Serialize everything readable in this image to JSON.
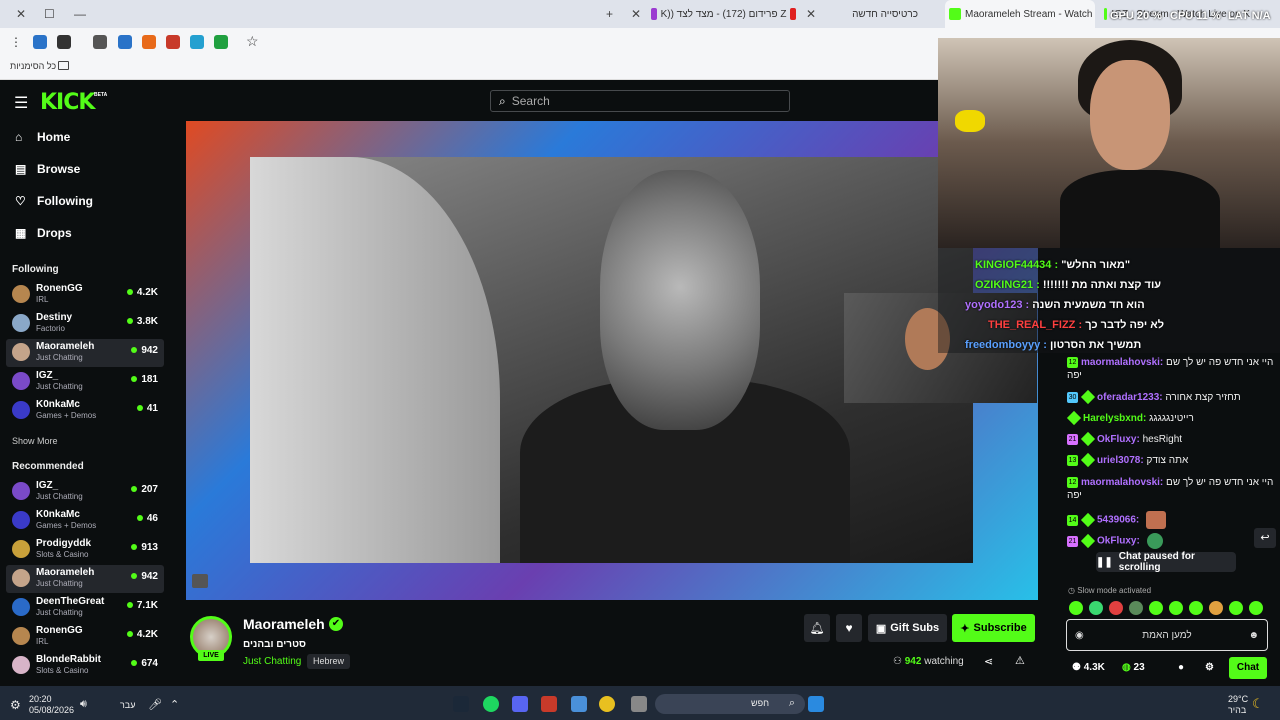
{
  "browser": {
    "tabs": [
      {
        "label": "K)) פרידום (172) - מצד לצד Z"
      },
      {
        "label": "כרטיסייה חדשה"
      },
      {
        "label": "Maorameleh Stream - Watch"
      },
      {
        "label": "IGZ_ Stream - Watch Live on K"
      }
    ],
    "overlay_stats": {
      "gpu": "GPU 20 %",
      "cpu": "CPU 11 %",
      "lat": "LAT N/A"
    },
    "bookmarks_label": "כל הסימניות"
  },
  "header": {
    "logo": "KICK",
    "beta": "BETA",
    "search_placeholder": "Search"
  },
  "sidebar": {
    "nav": [
      {
        "label": "Home",
        "icon": "home-icon"
      },
      {
        "label": "Browse",
        "icon": "browse-icon"
      },
      {
        "label": "Following",
        "icon": "heart-icon"
      },
      {
        "label": "Drops",
        "icon": "drops-icon"
      }
    ],
    "following_title": "Following",
    "following": [
      {
        "name": "RonenGG",
        "category": "IRL",
        "viewers": "4.2K"
      },
      {
        "name": "Destiny",
        "category": "Factorio",
        "viewers": "3.8K"
      },
      {
        "name": "Maorameleh",
        "category": "Just Chatting",
        "viewers": "942"
      },
      {
        "name": "IGZ_",
        "category": "Just Chatting",
        "viewers": "181"
      },
      {
        "name": "K0nkaMc",
        "category": "Games + Demos",
        "viewers": "41"
      }
    ],
    "show_more": "Show More",
    "recommended_title": "Recommended",
    "recommended": [
      {
        "name": "IGZ_",
        "category": "Just Chatting",
        "viewers": "207"
      },
      {
        "name": "K0nkaMc",
        "category": "Games + Demos",
        "viewers": "46"
      },
      {
        "name": "Prodigyddk",
        "category": "Slots & Casino",
        "viewers": "913"
      },
      {
        "name": "Maorameleh",
        "category": "Just Chatting",
        "viewers": "942"
      },
      {
        "name": "DeenTheGreat",
        "category": "Just Chatting",
        "viewers": "7.1K"
      },
      {
        "name": "RonenGG",
        "category": "IRL",
        "viewers": "4.2K"
      },
      {
        "name": "BlondeRabbit",
        "category": "Slots & Casino",
        "viewers": "674"
      }
    ]
  },
  "stream": {
    "channel": "Maorameleh",
    "live": "LIVE",
    "title": "סטרים ובהנים",
    "category": "Just Chatting",
    "language": "Hebrew",
    "gift_subs": "Gift Subs",
    "subscribe": "Subscribe",
    "viewers": "942",
    "watching": "watching"
  },
  "overlay_chat": [
    {
      "user": "KINGIOF44434 :",
      "text": "\"מאור החלש\"",
      "color": "#53fc18"
    },
    {
      "user": "OZIKING21 :",
      "text": "!!!!!!! עוד קצת ואתה מת",
      "color": "#53fc18"
    },
    {
      "user": "yoyodo123 :",
      "text": "הוא חד משמעית השנה",
      "color": "#b070ff"
    },
    {
      "user": "THE_REAL_FIZZ :",
      "text": "לא יפה לדבר כך",
      "color": "#ff4040"
    },
    {
      "user": "freedomboyyy :",
      "text": "תמשיך את הסרטון",
      "color": "#5aa0ff"
    }
  ],
  "chat": {
    "messages": [
      {
        "badge": "12",
        "user": "maormalahovski:",
        "text": "היי אני חדש פה יש לך שם יפה",
        "color": "#b070ff"
      },
      {
        "badge": "30",
        "user": "oferadar1233:",
        "text": "תחזיר קצת אחורה",
        "color": "#b070ff"
      },
      {
        "badge": "",
        "user": "Harelysbxnd:",
        "text": "רייטינגגגגג",
        "color": "#53fc18"
      },
      {
        "badge": "21",
        "user": "OkFluxy:",
        "text": "hesRight",
        "color": "#b070ff"
      },
      {
        "badge": "13",
        "user": "uriel3078:",
        "text": "אתה צודק",
        "color": "#b070ff"
      },
      {
        "badge": "12",
        "user": "maormalahovski:",
        "text": "היי אני חדש פה יש לך שם יפה",
        "color": "#b070ff"
      },
      {
        "badge": "14",
        "user": "5439066:",
        "text": "",
        "color": "#b070ff"
      },
      {
        "badge": "21",
        "user": "OkFluxy:",
        "text": "",
        "color": "#b070ff"
      }
    ],
    "paused_label": "Chat paused for scrolling",
    "slow_mode": "Slow mode activated",
    "input_placeholder": "למען האמת",
    "points": "4.3K",
    "kick_points": "23",
    "chat_button": "Chat"
  },
  "taskbar": {
    "time": "20:20",
    "date": "05/08/2026",
    "lang": "עבר",
    "search": "חפש",
    "weather": "29°C",
    "weather_desc": "בהיר"
  }
}
